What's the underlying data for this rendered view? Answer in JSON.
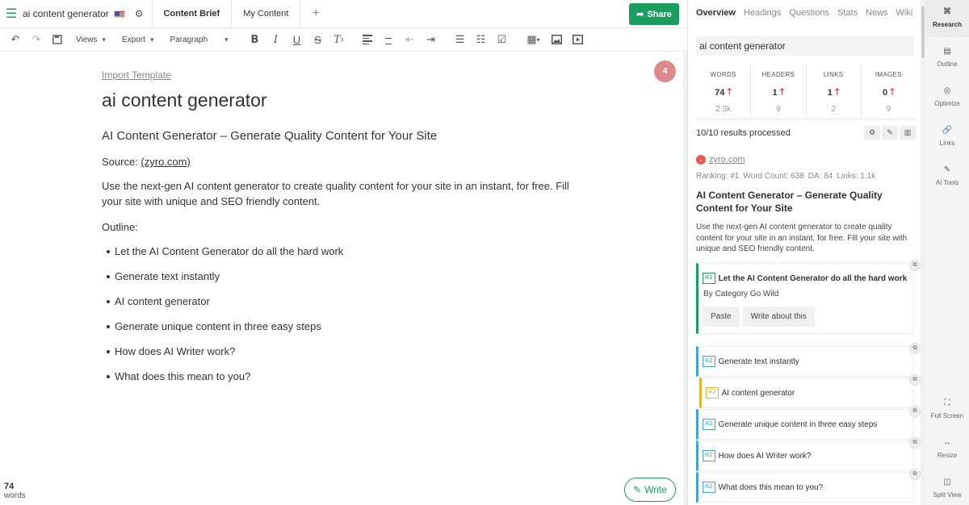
{
  "topbar": {
    "title": "ai content generator",
    "tabs": [
      "Content Brief",
      "My Content"
    ],
    "share_label": "Share"
  },
  "toolbar": {
    "views_label": "Views",
    "export_label": "Export",
    "paragraph_label": "Paragraph"
  },
  "editor": {
    "import_template": "Import Template",
    "badge": "4",
    "title": "ai content generator",
    "heading": "AI Content Generator – Generate Quality Content for Your Site",
    "source_prefix": "Source: ",
    "source_link": "(zyro.com)",
    "description": "Use the next-gen AI content generator to create quality content for your site in an instant, for free. Fill your site with unique and SEO friendly content.",
    "outline_label": "Outline:",
    "outline": [
      "Let the AI Content Generator do all the hard work",
      "Generate text instantly",
      "AI content generator",
      "Generate unique content in three easy steps",
      "How does AI Writer work?",
      "What does this mean to you?"
    ],
    "word_count": "74",
    "word_label": "words",
    "write_label": "Write"
  },
  "research": {
    "tabs": [
      "Overview",
      "Headings",
      "Questions",
      "Stats",
      "News",
      "Wiki"
    ],
    "search_value": "ai content generator",
    "stats": [
      {
        "label": "WORDS",
        "value": "74",
        "target": "2.3k"
      },
      {
        "label": "HEADERS",
        "value": "1",
        "target": "9"
      },
      {
        "label": "LINKS",
        "value": "1",
        "target": "2"
      },
      {
        "label": "IMAGES",
        "value": "0",
        "target": "9"
      }
    ],
    "results_text": "10/10 results processed",
    "result": {
      "site": "zyro.com",
      "ranking": "Ranking: #1",
      "word_count": "Word Count: 638",
      "da": "DA: 84",
      "links": "Links: 1.1k",
      "title": "AI Content Generator – Generate Quality Content for Your Site",
      "description": "Use the next-gen AI content generator to create quality content for your site in an instant, for free. Fill your site with unique and SEO friendly content."
    },
    "headings": [
      {
        "tag": "H1",
        "text": "Let the AI Content Generator do all the hard work",
        "sub": "By Category Go Wild",
        "buttons": [
          "Paste",
          "Write about this"
        ]
      },
      {
        "tag": "H2",
        "text": "Generate text instantly"
      },
      {
        "tag": "H3",
        "text": "AI content generator"
      },
      {
        "tag": "H2",
        "text": "Generate unique content in three easy steps"
      },
      {
        "tag": "H2",
        "text": "How does AI Writer work?"
      },
      {
        "tag": "H2",
        "text": "What does this mean to you?"
      }
    ]
  },
  "sidebar": {
    "items": [
      "Research",
      "Outline",
      "Optimize",
      "Links",
      "AI Tools",
      "Full Screen",
      "Resize",
      "Split View"
    ]
  },
  "colors": {
    "accent": "#1a9e5f",
    "h2": "#3ea4d9",
    "h3": "#e7b12f",
    "up_arrow": "#dd3333"
  }
}
